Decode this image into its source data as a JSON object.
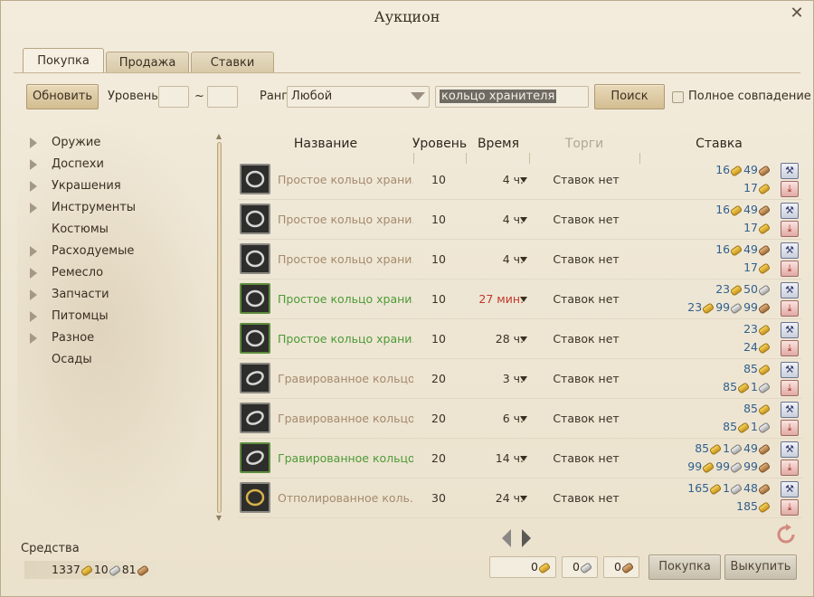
{
  "window": {
    "title": "Аукцион",
    "close_glyph": "✕"
  },
  "tabs": [
    {
      "label": "Покупка",
      "active": true
    },
    {
      "label": "Продажа",
      "active": false
    },
    {
      "label": "Ставки",
      "active": false
    }
  ],
  "toolbar": {
    "refresh_label": "Обновить",
    "level_label": "Уровень",
    "level_from": "",
    "level_sep": "~",
    "level_to": "",
    "rank_label": "Ранг",
    "rank_value": "Любой",
    "search_value": "кольцо хранителя",
    "search_label": "Поиск",
    "exact_label": "Полное совпадение",
    "exact_checked": false
  },
  "categories": [
    {
      "label": "Оружие",
      "expandable": true
    },
    {
      "label": "Доспехи",
      "expandable": true
    },
    {
      "label": "Украшения",
      "expandable": true
    },
    {
      "label": "Инструменты",
      "expandable": true
    },
    {
      "label": "Костюмы",
      "expandable": false
    },
    {
      "label": "Расходуемые",
      "expandable": true
    },
    {
      "label": "Ремесло",
      "expandable": true
    },
    {
      "label": "Запчасти",
      "expandable": true
    },
    {
      "label": "Питомцы",
      "expandable": true
    },
    {
      "label": "Разное",
      "expandable": true
    },
    {
      "label": "Осады",
      "expandable": false
    }
  ],
  "columns": {
    "name": "Название",
    "level": "Уровень",
    "time": "Время",
    "bids": "Торги",
    "bid": "Ставка"
  },
  "rows": [
    {
      "name": "Простое кольцо храни..",
      "name_color": "tan",
      "icon": "plain-ring-icon",
      "icon_border": "gray",
      "level": "10",
      "time": "4 ч.",
      "time_color": "dark",
      "bids": "Ставок нет",
      "line1": [
        [
          "16",
          "g"
        ],
        [
          "49",
          "c"
        ]
      ],
      "line2": [
        [
          "17",
          "g"
        ]
      ]
    },
    {
      "name": "Простое кольцо храни..",
      "name_color": "tan",
      "icon": "plain-ring-icon",
      "icon_border": "gray",
      "level": "10",
      "time": "4 ч.",
      "time_color": "dark",
      "bids": "Ставок нет",
      "line1": [
        [
          "16",
          "g"
        ],
        [
          "49",
          "c"
        ]
      ],
      "line2": [
        [
          "17",
          "g"
        ]
      ]
    },
    {
      "name": "Простое кольцо храни..",
      "name_color": "tan",
      "icon": "plain-ring-icon",
      "icon_border": "gray",
      "level": "10",
      "time": "4 ч.",
      "time_color": "dark",
      "bids": "Ставок нет",
      "line1": [
        [
          "16",
          "g"
        ],
        [
          "49",
          "c"
        ]
      ],
      "line2": [
        [
          "17",
          "g"
        ]
      ]
    },
    {
      "name": "Простое кольцо храни..",
      "name_color": "green",
      "icon": "plain-ring-icon",
      "icon_border": "green",
      "level": "10",
      "time": "27 мин.",
      "time_color": "red",
      "bids": "Ставок нет",
      "line1": [
        [
          "23",
          "g"
        ],
        [
          "50",
          "s"
        ]
      ],
      "line2": [
        [
          "23",
          "g"
        ],
        [
          "99",
          "s"
        ],
        [
          "99",
          "c"
        ]
      ]
    },
    {
      "name": "Простое кольцо храни..",
      "name_color": "green",
      "icon": "plain-ring-icon",
      "icon_border": "green",
      "level": "10",
      "time": "28 ч.",
      "time_color": "dark",
      "bids": "Ставок нет",
      "line1": [
        [
          "23",
          "g"
        ]
      ],
      "line2": [
        [
          "24",
          "g"
        ]
      ]
    },
    {
      "name": "Гравированное кольцо ..",
      "name_color": "tan",
      "icon": "engraved-ring-icon",
      "icon_border": "gray",
      "level": "20",
      "time": "3 ч.",
      "time_color": "dark",
      "bids": "Ставок нет",
      "line1": [
        [
          "85",
          "g"
        ]
      ],
      "line2": [
        [
          "85",
          "g"
        ],
        [
          "1",
          "s"
        ]
      ]
    },
    {
      "name": "Гравированное кольцо ..",
      "name_color": "tan",
      "icon": "engraved-ring-icon",
      "icon_border": "gray",
      "level": "20",
      "time": "6 ч.",
      "time_color": "dark",
      "bids": "Ставок нет",
      "line1": [
        [
          "85",
          "g"
        ]
      ],
      "line2": [
        [
          "85",
          "g"
        ],
        [
          "1",
          "s"
        ]
      ]
    },
    {
      "name": "Гравированное кольцо ..",
      "name_color": "green",
      "icon": "engraved-ring-icon",
      "icon_border": "green",
      "level": "20",
      "time": "14 ч.",
      "time_color": "dark",
      "bids": "Ставок нет",
      "line1": [
        [
          "85",
          "g"
        ],
        [
          "1",
          "s"
        ],
        [
          "49",
          "c"
        ]
      ],
      "line2": [
        [
          "99",
          "g"
        ],
        [
          "99",
          "s"
        ],
        [
          "99",
          "c"
        ]
      ]
    },
    {
      "name": "Отполированное коль..",
      "name_color": "tan",
      "icon": "polished-ring-icon",
      "icon_border": "gray",
      "level": "30",
      "time": "24 ч.",
      "time_color": "dark",
      "bids": "Ставок нет",
      "line1": [
        [
          "165",
          "g"
        ],
        [
          "1",
          "s"
        ],
        [
          "48",
          "c"
        ]
      ],
      "line2": [
        [
          "185",
          "g"
        ]
      ]
    }
  ],
  "footer": {
    "funds_label": "Средства",
    "funds": [
      [
        "1337",
        "g"
      ],
      [
        "10",
        "s"
      ],
      [
        "81",
        "c"
      ]
    ],
    "cost_gold": "0",
    "cost_silver": "0",
    "cost_copper": "0",
    "buy_label": "Покупка",
    "buyout_label": "Выкупить"
  },
  "icons": {
    "bid_action": "bid-hammer-icon",
    "buyout_action": "buyout-download-icon",
    "pager_prev": "chevron-left-icon",
    "pager_next": "chevron-right-icon",
    "refresh": "refresh-icon"
  },
  "colors": {
    "price_blue": "#2f5f8f",
    "item_green": "#4d9a37",
    "item_tan": "#a48a6e",
    "time_red": "#c0372b"
  }
}
